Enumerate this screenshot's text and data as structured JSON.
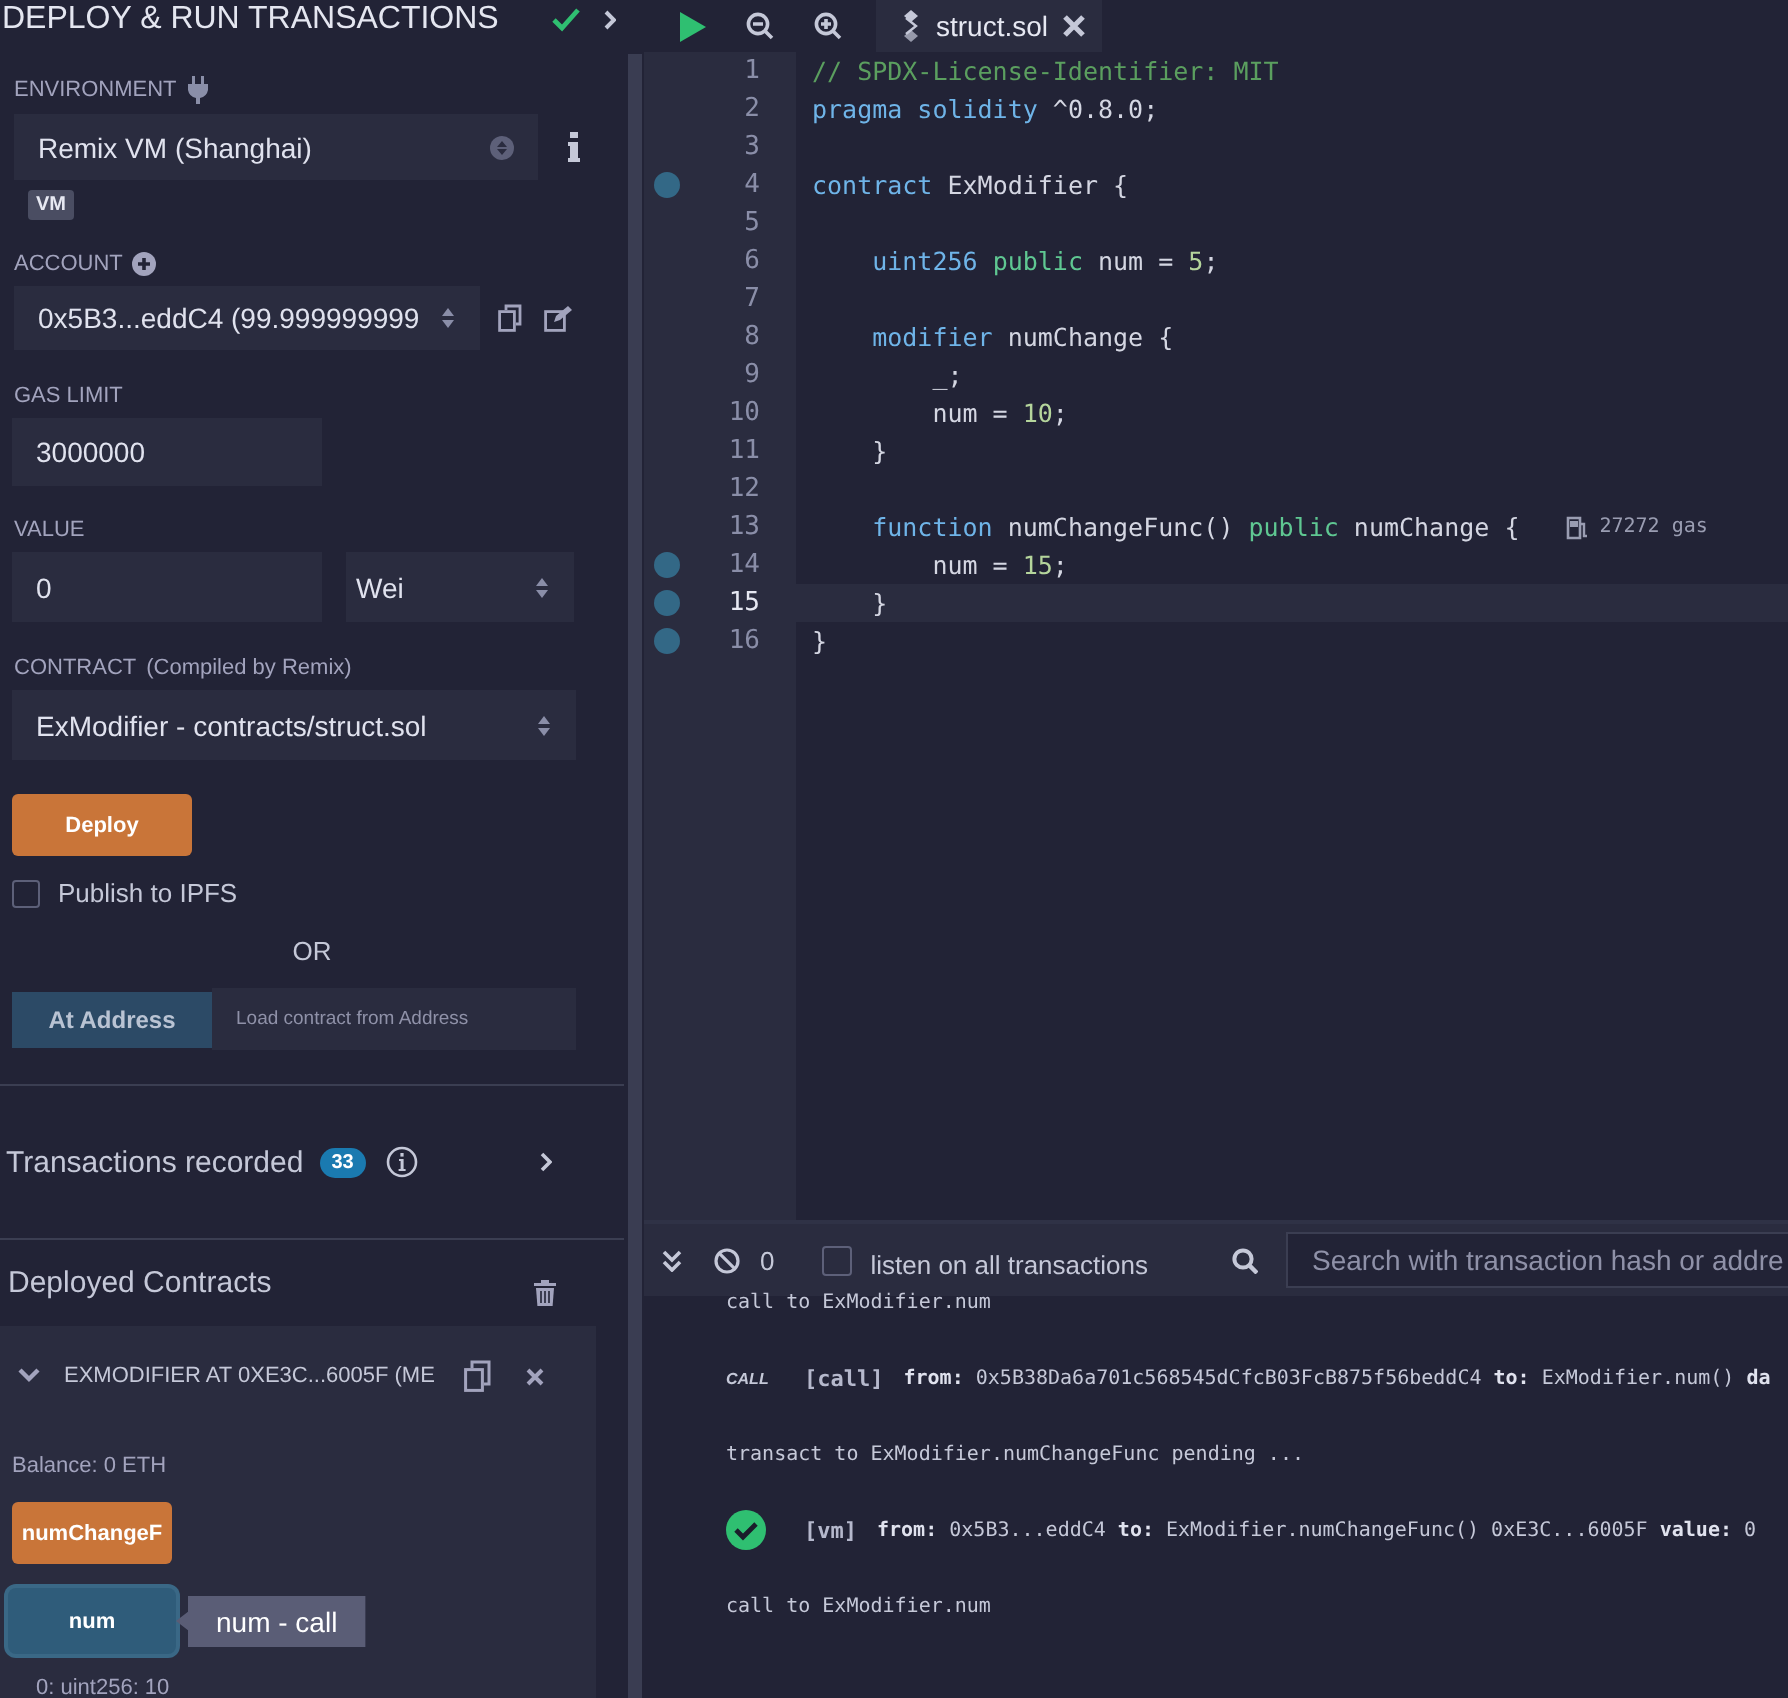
{
  "panel": {
    "title": "DEPLOY & RUN TRANSACTIONS"
  },
  "environment": {
    "label": "ENVIRONMENT",
    "value": "Remix VM (Shanghai)",
    "badge": "VM"
  },
  "account": {
    "label": "ACCOUNT",
    "value": "0x5B3...eddC4 (99.999999999"
  },
  "gas_limit": {
    "label": "GAS LIMIT",
    "value": "3000000"
  },
  "value": {
    "label": "VALUE",
    "value": "0",
    "unit": "Wei"
  },
  "contract": {
    "label": "CONTRACT",
    "note": "(Compiled by Remix)",
    "value": "ExModifier - contracts/struct.sol"
  },
  "deploy_button": "Deploy",
  "publish": {
    "label": "Publish to IPFS",
    "checked": false
  },
  "or": "OR",
  "at_address": {
    "button": "At Address",
    "placeholder": "Load contract from Address"
  },
  "transactions": {
    "label": "Transactions recorded",
    "count": "33"
  },
  "deployed": {
    "title": "Deployed Contracts",
    "instance": {
      "title": "EXMODIFIER AT 0XE3C...6005F (ME",
      "expanded": true,
      "balance": "Balance: 0 ETH",
      "functions": [
        {
          "label": "numChangeF",
          "kind": "transact"
        },
        {
          "label": "num",
          "kind": "call",
          "tooltip": "num - call",
          "output": "0: uint256: 10"
        }
      ]
    }
  },
  "editor": {
    "tabs": [
      {
        "label": "struct.sol",
        "selected": true
      }
    ],
    "lines": [
      {
        "number": "1",
        "breakpoint": false,
        "selected": false,
        "tokens": [
          {
            "kind": "comment",
            "text": "// SPDX-License-Identifier: MIT"
          }
        ]
      },
      {
        "number": "2",
        "breakpoint": false,
        "selected": false,
        "tokens": [
          {
            "kind": "keyword",
            "text": "pragma solidity"
          },
          {
            "kind": "plain",
            "text": " ^0.8.0;"
          }
        ]
      },
      {
        "number": "3",
        "breakpoint": false,
        "selected": false
      },
      {
        "number": "4",
        "breakpoint": true,
        "selected": false,
        "tokens": [
          {
            "kind": "keyword",
            "text": "contract"
          },
          {
            "kind": "plain",
            "text": " ExModifier {"
          }
        ]
      },
      {
        "number": "5",
        "breakpoint": false,
        "selected": false
      },
      {
        "number": "6",
        "breakpoint": false,
        "selected": false,
        "tokens": [
          {
            "kind": "keyword",
            "text": "    uint256"
          },
          {
            "kind": "visibility",
            "text": " public"
          },
          {
            "kind": "plain",
            "text": " num = "
          },
          {
            "kind": "number",
            "text": "5"
          },
          {
            "kind": "plain",
            "text": ";"
          }
        ]
      },
      {
        "number": "7",
        "breakpoint": false,
        "selected": false
      },
      {
        "number": "8",
        "breakpoint": false,
        "selected": false,
        "tokens": [
          {
            "kind": "keyword",
            "text": "    modifier"
          },
          {
            "kind": "plain",
            "text": " numChange {"
          }
        ]
      },
      {
        "number": "9",
        "breakpoint": false,
        "selected": false,
        "tokens": [
          {
            "kind": "plain",
            "text": "        _;"
          }
        ]
      },
      {
        "number": "10",
        "breakpoint": false,
        "selected": false,
        "tokens": [
          {
            "kind": "plain",
            "text": "        num = "
          },
          {
            "kind": "number",
            "text": "10"
          },
          {
            "kind": "plain",
            "text": ";"
          }
        ]
      },
      {
        "number": "11",
        "breakpoint": false,
        "selected": false,
        "tokens": [
          {
            "kind": "plain",
            "text": "    }"
          }
        ]
      },
      {
        "number": "12",
        "breakpoint": false,
        "selected": false
      },
      {
        "number": "13",
        "breakpoint": false,
        "selected": false,
        "gas": "27272 gas",
        "tokens": [
          {
            "kind": "keyword",
            "text": "    function"
          },
          {
            "kind": "plain",
            "text": " numChangeFunc() "
          },
          {
            "kind": "visibility",
            "text": "public"
          },
          {
            "kind": "plain",
            "text": " numChange {"
          }
        ]
      },
      {
        "number": "14",
        "breakpoint": true,
        "selected": false,
        "tokens": [
          {
            "kind": "plain",
            "text": "        num = "
          },
          {
            "kind": "number",
            "text": "15"
          },
          {
            "kind": "plain",
            "text": ";"
          }
        ]
      },
      {
        "number": "15",
        "breakpoint": true,
        "selected": true,
        "tokens": [
          {
            "kind": "plain",
            "text": "    }"
          }
        ]
      },
      {
        "number": "16",
        "breakpoint": true,
        "selected": false,
        "tokens": [
          {
            "kind": "plain",
            "text": "}"
          }
        ]
      }
    ]
  },
  "terminal": {
    "count": "0",
    "listen": {
      "label": "listen on all transactions",
      "checked": false
    },
    "search": {
      "placeholder": "Search with transaction hash or addre"
    },
    "logs": [
      {
        "kind": "info",
        "text": "call to ExModifier.num"
      },
      {
        "kind": "call",
        "badge": "CALL",
        "tag": "[call]",
        "text": "**from:** 0x5B38Da6a701c568545dCfcB03FcB875f56beddC4 **to:** ExModifier.num() **da**"
      },
      {
        "kind": "info",
        "text": "transact to ExModifier.numChangeFunc pending ..."
      },
      {
        "kind": "success",
        "tag": "[vm]",
        "text": "**from:** 0x5B3...eddC4 **to:** ExModifier.numChangeFunc() 0xE3C...6005F **value:** 0"
      },
      {
        "kind": "info",
        "text": "call to ExModifier.num"
      }
    ]
  }
}
